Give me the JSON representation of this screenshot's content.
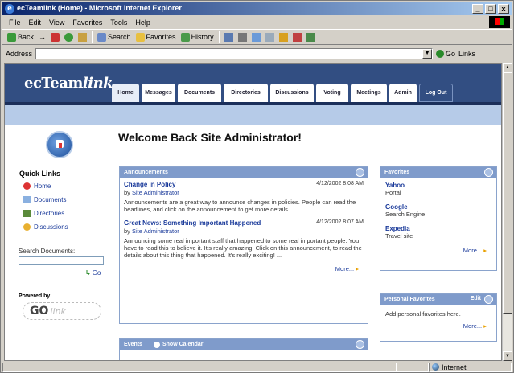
{
  "window": {
    "title": "ecTeamlink (Home) - Microsoft Internet Explorer",
    "min": "_",
    "max": "□",
    "close": "x"
  },
  "menu": [
    "File",
    "Edit",
    "View",
    "Favorites",
    "Tools",
    "Help"
  ],
  "toolbar": {
    "back": "Back",
    "forward": "→",
    "search": "Search",
    "favorites": "Favorites",
    "history": "History"
  },
  "address": {
    "label": "Address",
    "value": "",
    "go": "Go",
    "links": "Links"
  },
  "page": {
    "logo_prefix": "ec",
    "logo_main": "Team",
    "logo_italic": "link",
    "tabs": [
      "Home",
      "Messages",
      "Documents",
      "Directories",
      "Discussions",
      "Voting",
      "Meetings",
      "Admin",
      "Log Out"
    ],
    "welcome": "Welcome Back Site Administrator!",
    "quick_links": {
      "title": "Quick Links",
      "items": [
        "Home",
        "Documents",
        "Directories",
        "Discussions"
      ]
    },
    "search": {
      "label": "Search Documents:",
      "go": "Go"
    },
    "powered_by": {
      "label": "Powered by",
      "logo": "GO",
      "logo_suffix": "link"
    },
    "announcements": {
      "title": "Announcements",
      "items": [
        {
          "title": "Change in Policy",
          "by": "by",
          "author": "Site Administrator",
          "date": "4/12/2002 8:08 AM",
          "text": "Announcements are a great way to announce changes in policies. People can read the headlines, and click on the announcement to get more details."
        },
        {
          "title": "Great News: Something Important Happened",
          "by": "by",
          "author": "Site Administrator",
          "date": "4/12/2002 8:07 AM",
          "text": "Announcing some real important staff that happened to some real important people. You have to read this to believe it. It's really amazing. Click on this announcement, to read the details about this thing that happened. It's really exciting! ..."
        }
      ],
      "more": "More..."
    },
    "events": {
      "title": "Events",
      "calendar": "Show Calendar"
    },
    "favorites": {
      "title": "Favorites",
      "items": [
        {
          "name": "Yahoo",
          "desc": "Portal"
        },
        {
          "name": "Google",
          "desc": "Search Engine"
        },
        {
          "name": "Expedia",
          "desc": "Travel site"
        }
      ],
      "more": "More..."
    },
    "personal_favorites": {
      "title": "Personal Favorites",
      "edit": "Edit",
      "text": "Add personal favorites here.",
      "more": "More..."
    }
  },
  "status": {
    "left": "",
    "zone": "Internet"
  },
  "colors": {
    "header": "#324e82",
    "panel_header": "#7f9bcb",
    "link": "#1a3a9a"
  }
}
